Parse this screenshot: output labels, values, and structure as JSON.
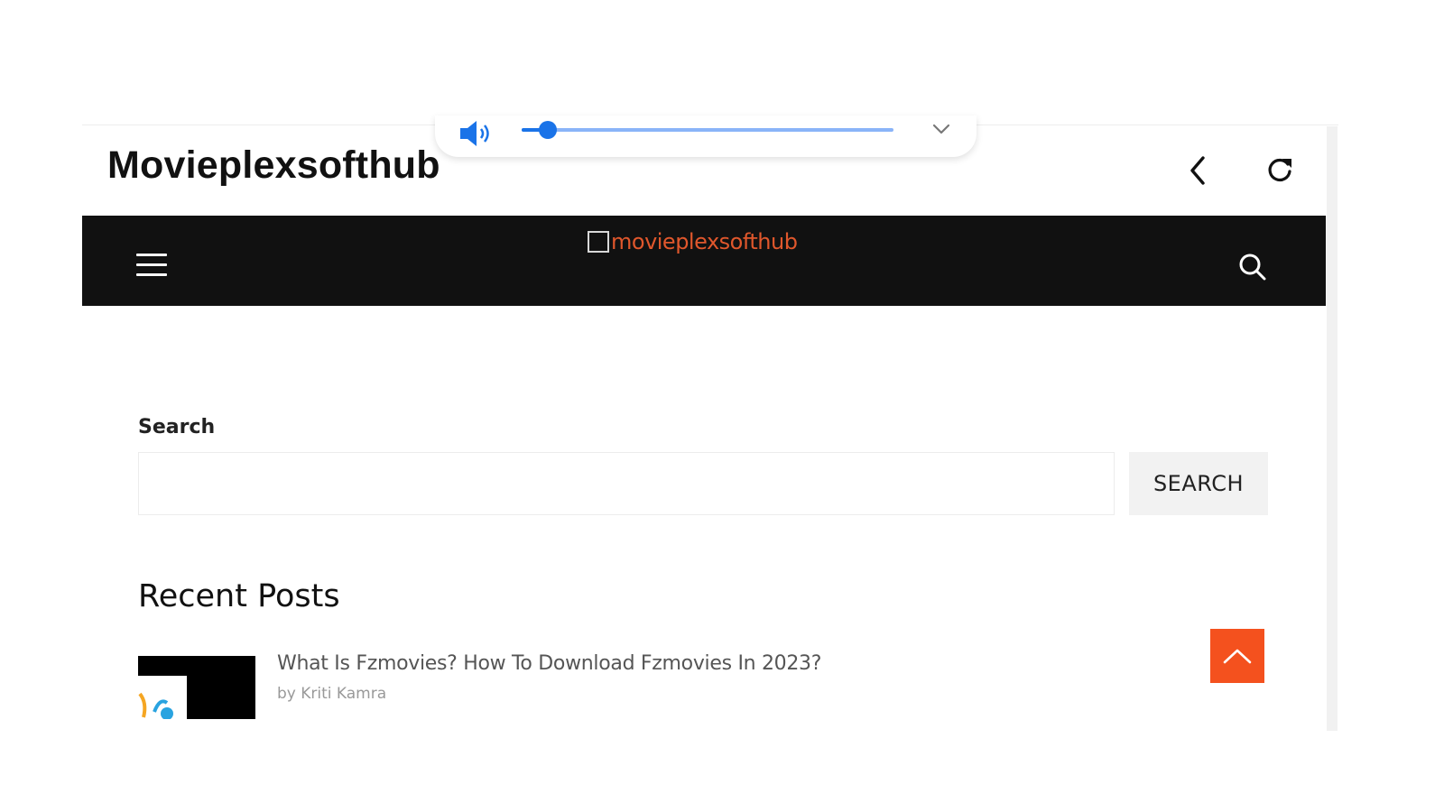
{
  "volume_overlay": {
    "level": 0.07,
    "speaker_icon": "speaker-icon",
    "expand_icon": "chevron-down-icon",
    "colors": {
      "track": "#8ab4f8",
      "fill": "#1a73e8"
    }
  },
  "header": {
    "title": "Movieplexsofthub",
    "back_icon": "chevron-left-icon",
    "reload_icon": "reload-icon"
  },
  "navbar": {
    "menu_icon": "hamburger-icon",
    "logo_text": "movieplexsofthub",
    "search_icon": "search-icon",
    "colors": {
      "background": "#111111",
      "logo": "#e0572c"
    }
  },
  "search_widget": {
    "label": "Search",
    "input_value": "",
    "button_label": "SEARCH"
  },
  "recent_posts": {
    "heading": "Recent Posts",
    "items": [
      {
        "title": "What Is Fzmovies? How To Download Fzmovies In 2023?",
        "byline": "by",
        "author": "Kriti Kamra"
      }
    ]
  },
  "scroll_to_top": {
    "icon": "chevron-up-icon",
    "color": "#f4511e"
  }
}
